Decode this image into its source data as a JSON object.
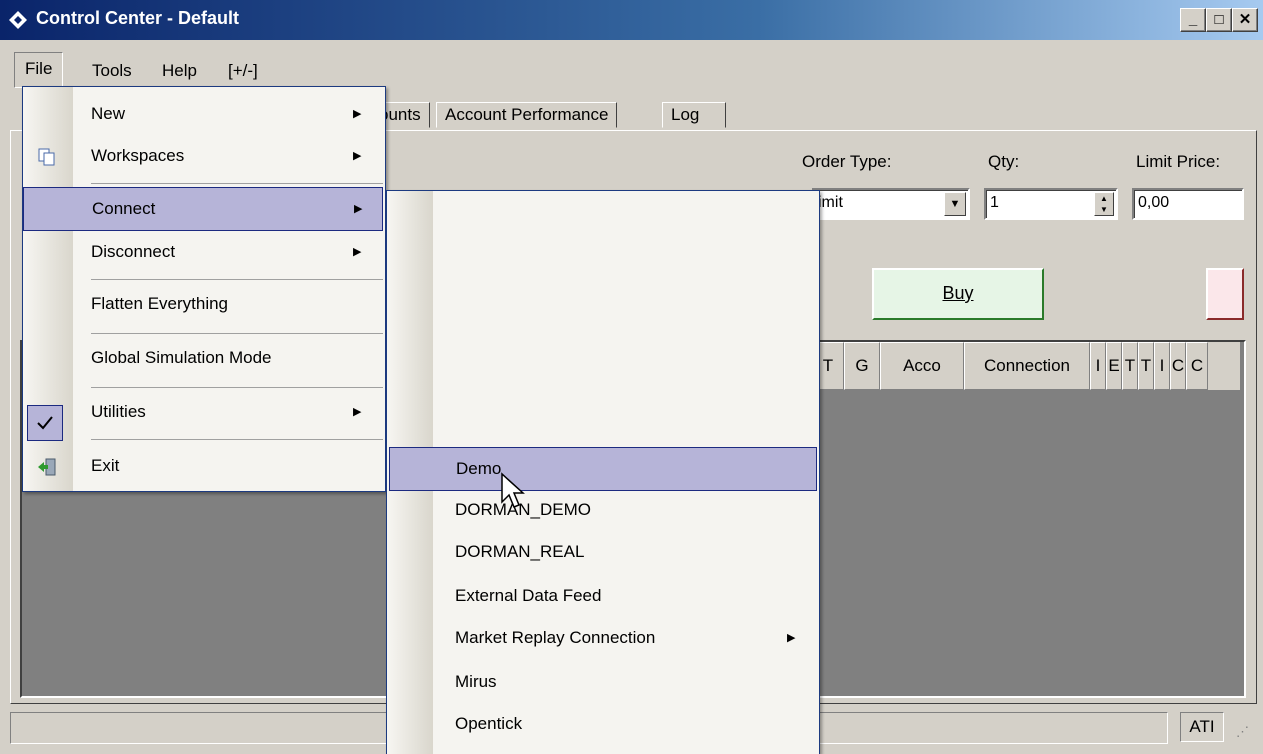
{
  "window": {
    "title": "Control Center - Default",
    "minimize": "_",
    "maximize": "□",
    "close": "✕"
  },
  "menubar": {
    "file": "File",
    "tools": "Tools",
    "help": "Help",
    "toggle": "[+/-]"
  },
  "tabs": {
    "accounts_partial": "ounts",
    "account_performance": "Account Performance",
    "log": "Log"
  },
  "order": {
    "order_type_label": "Order Type:",
    "qty_label": "Qty:",
    "limit_price_label": "Limit Price:",
    "order_type_value": "imit",
    "qty_value": "1",
    "limit_price_value": "0,00",
    "buy_label": "Buy"
  },
  "grid_columns": [
    "T",
    "G",
    "Acco",
    "Connection",
    "I",
    "E",
    "T",
    "T",
    "I",
    "C",
    "C"
  ],
  "status": {
    "ati": "ATI"
  },
  "file_menu": {
    "items": [
      {
        "label": "New",
        "submenu": true
      },
      {
        "label": "Workspaces",
        "submenu": true,
        "icon": "workspaces-icon"
      },
      {
        "label": "Connect",
        "submenu": true,
        "highlighted": true
      },
      {
        "label": "Disconnect",
        "submenu": true
      },
      {
        "label": "Flatten Everything",
        "submenu": false
      },
      {
        "label": "Global Simulation Mode",
        "submenu": false,
        "checked": true
      },
      {
        "label": "Utilities",
        "submenu": true
      },
      {
        "label": "Exit",
        "submenu": false,
        "icon": "exit-icon"
      }
    ]
  },
  "connect_menu": {
    "items": [
      {
        "label": "Demo",
        "highlighted": true
      },
      {
        "label": "DORMAN_DEMO"
      },
      {
        "label": "DORMAN_REAL"
      },
      {
        "label": "External Data Feed"
      },
      {
        "label": "Market Replay Connection",
        "submenu": true
      },
      {
        "label": "Mirus"
      },
      {
        "label": "Opentick"
      }
    ]
  },
  "colors": {
    "menu_highlight": "#b6b4d8",
    "title_start": "#0a246a",
    "title_end": "#a6caf0",
    "buy_bg": "#e6f5e6"
  }
}
